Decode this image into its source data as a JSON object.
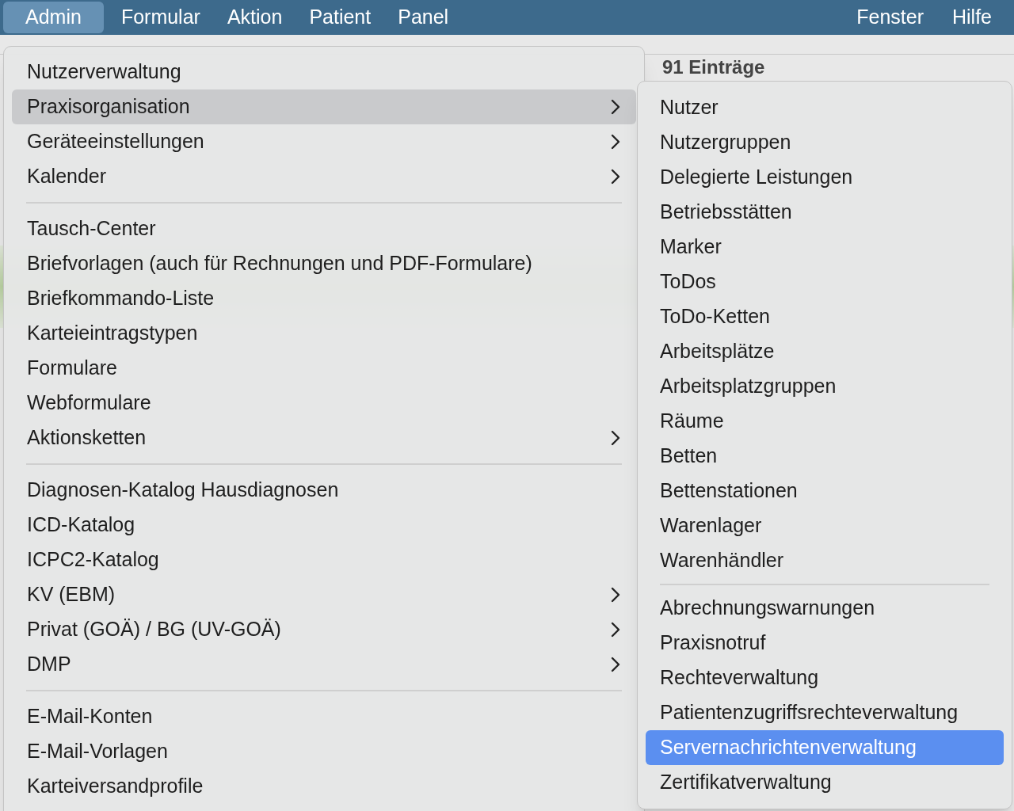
{
  "menu_bar": {
    "left": [
      {
        "label": "Admin",
        "selected": true
      },
      {
        "label": "Formular",
        "selected": false
      },
      {
        "label": "Aktion",
        "selected": false
      },
      {
        "label": "Patient",
        "selected": false
      },
      {
        "label": "Panel",
        "selected": false
      }
    ],
    "right": [
      {
        "label": "Fenster",
        "selected": false
      },
      {
        "label": "Hilfe",
        "selected": false
      }
    ]
  },
  "background": {
    "entry_count": "91 Einträge"
  },
  "admin_menu": {
    "groups": [
      [
        {
          "label": "Nutzerverwaltung",
          "submenu": false,
          "selected": false
        },
        {
          "label": "Praxisorganisation",
          "submenu": true,
          "selected": true
        },
        {
          "label": "Geräteeinstellungen",
          "submenu": true,
          "selected": false
        },
        {
          "label": "Kalender",
          "submenu": true,
          "selected": false
        }
      ],
      [
        {
          "label": "Tausch-Center",
          "submenu": false,
          "selected": false
        },
        {
          "label": "Briefvorlagen (auch für Rechnungen und PDF-Formulare)",
          "submenu": false,
          "selected": false
        },
        {
          "label": "Briefkommando-Liste",
          "submenu": false,
          "selected": false
        },
        {
          "label": "Karteieintragstypen",
          "submenu": false,
          "selected": false
        },
        {
          "label": "Formulare",
          "submenu": false,
          "selected": false
        },
        {
          "label": "Webformulare",
          "submenu": false,
          "selected": false
        },
        {
          "label": "Aktionsketten",
          "submenu": true,
          "selected": false
        }
      ],
      [
        {
          "label": "Diagnosen-Katalog Hausdiagnosen",
          "submenu": false,
          "selected": false
        },
        {
          "label": "ICD-Katalog",
          "submenu": false,
          "selected": false
        },
        {
          "label": "ICPC2-Katalog",
          "submenu": false,
          "selected": false
        },
        {
          "label": "KV (EBM)",
          "submenu": true,
          "selected": false
        },
        {
          "label": "Privat (GOÄ) / BG (UV-GOÄ)",
          "submenu": true,
          "selected": false
        },
        {
          "label": "DMP",
          "submenu": true,
          "selected": false
        }
      ],
      [
        {
          "label": "E-Mail-Konten",
          "submenu": false,
          "selected": false
        },
        {
          "label": "E-Mail-Vorlagen",
          "submenu": false,
          "selected": false
        },
        {
          "label": "Karteiversandprofile",
          "submenu": false,
          "selected": false
        }
      ]
    ]
  },
  "submenu": {
    "groups": [
      [
        {
          "label": "Nutzer",
          "selected": false
        },
        {
          "label": "Nutzergruppen",
          "selected": false
        },
        {
          "label": "Delegierte Leistungen",
          "selected": false
        },
        {
          "label": "Betriebsstätten",
          "selected": false
        },
        {
          "label": "Marker",
          "selected": false
        },
        {
          "label": "ToDos",
          "selected": false
        },
        {
          "label": "ToDo-Ketten",
          "selected": false
        },
        {
          "label": "Arbeitsplätze",
          "selected": false
        },
        {
          "label": "Arbeitsplatzgruppen",
          "selected": false
        },
        {
          "label": "Räume",
          "selected": false
        },
        {
          "label": "Betten",
          "selected": false
        },
        {
          "label": "Bettenstationen",
          "selected": false
        },
        {
          "label": "Warenlager",
          "selected": false
        },
        {
          "label": "Warenhändler",
          "selected": false
        }
      ],
      [
        {
          "label": "Abrechnungswarnungen",
          "selected": false
        },
        {
          "label": "Praxisnotruf",
          "selected": false
        },
        {
          "label": "Rechteverwaltung",
          "selected": false
        },
        {
          "label": "Patientenzugriffsrechteverwaltung",
          "selected": false
        },
        {
          "label": "Servernachrichtenverwaltung",
          "selected": true
        },
        {
          "label": "Zertifikatverwaltung",
          "selected": false
        }
      ]
    ]
  }
}
